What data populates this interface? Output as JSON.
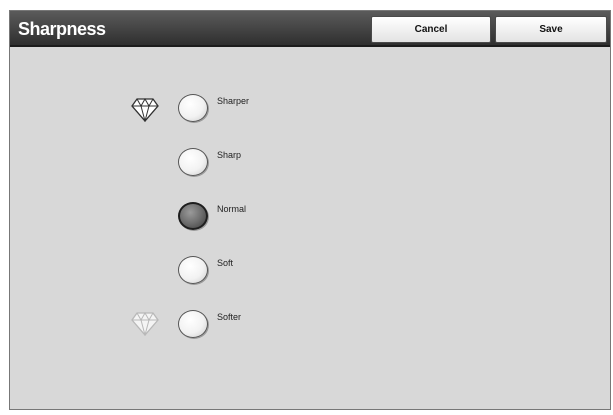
{
  "header": {
    "title": "Sharpness",
    "cancel_label": "Cancel",
    "save_label": "Save"
  },
  "options": [
    {
      "label": "Sharper",
      "selected": false
    },
    {
      "label": "Sharp",
      "selected": false
    },
    {
      "label": "Normal",
      "selected": true
    },
    {
      "label": "Soft",
      "selected": false
    },
    {
      "label": "Softer",
      "selected": false
    }
  ],
  "icons": {
    "sharp_end": "sharp-diamond-icon",
    "soft_end": "soft-diamond-icon"
  },
  "colors": {
    "header_bg": "#3a3a3a",
    "panel_bg": "#d8d8d8",
    "selected_radio": "#6e6e6e"
  }
}
